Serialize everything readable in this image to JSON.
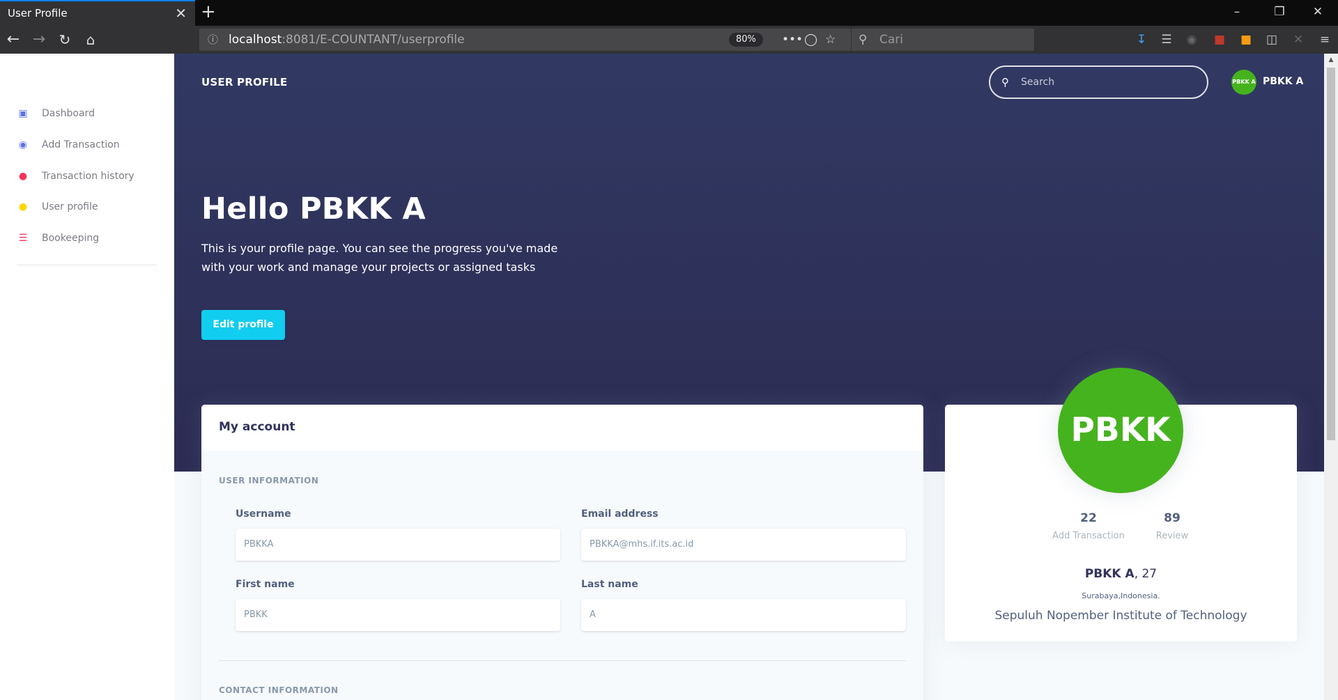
{
  "browser": {
    "tab_title": "User Profile",
    "tab_close": "✕",
    "new_tab": "+",
    "url_host": "localhost",
    "url_path": ":8081/E-COUNTANT/userprofile",
    "zoom": "80%",
    "search_placeholder": "Cari",
    "menu_dots": "•••"
  },
  "sidebar": {
    "items": [
      {
        "label": "Dashboard",
        "icon": "monitor-icon",
        "color": "#5e72e4"
      },
      {
        "label": "Add Transaction",
        "icon": "planet-icon",
        "color": "#5e72e4"
      },
      {
        "label": "Transaction history",
        "icon": "pin-icon",
        "color": "#f5365c"
      },
      {
        "label": "User profile",
        "icon": "user-icon",
        "color": "#ffd600"
      },
      {
        "label": "Bookeeping",
        "icon": "list-icon",
        "color": "#f5365c"
      }
    ]
  },
  "header": {
    "title": "USER PROFILE",
    "search_placeholder": "Search",
    "avatar_text": "PBKK A",
    "user_name": "PBKK A"
  },
  "hero": {
    "greeting": "Hello PBKK A",
    "intro": "This is your profile page. You can see the progress you've made with your work and manage your projects or assigned tasks",
    "edit_button": "Edit profile"
  },
  "account": {
    "title": "My account",
    "user_info_title": "USER INFORMATION",
    "contact_info_title": "CONTACT INFORMATION",
    "fields": {
      "username": {
        "label": "Username",
        "placeholder": "PBKKA"
      },
      "email": {
        "label": "Email address",
        "placeholder": "PBKKA@mhs.if.its.ac.id"
      },
      "first_name": {
        "label": "First name",
        "placeholder": "PBKK"
      },
      "last_name": {
        "label": "Last name",
        "placeholder": "A"
      }
    }
  },
  "profile_card": {
    "avatar_text": "PBKK A",
    "stats": [
      {
        "value": "22",
        "label": "Add Transaction"
      },
      {
        "value": "89",
        "label": "Review"
      }
    ],
    "name": "PBKK A",
    "age_suffix": ", 27",
    "location": "Surabaya,Indonesia.",
    "institution": "Sepuluh Nopember Institute of Technology"
  },
  "colors": {
    "hero_bg": "#2e3159",
    "accent_button": "#11cdef",
    "avatar_green": "#45b31e"
  }
}
